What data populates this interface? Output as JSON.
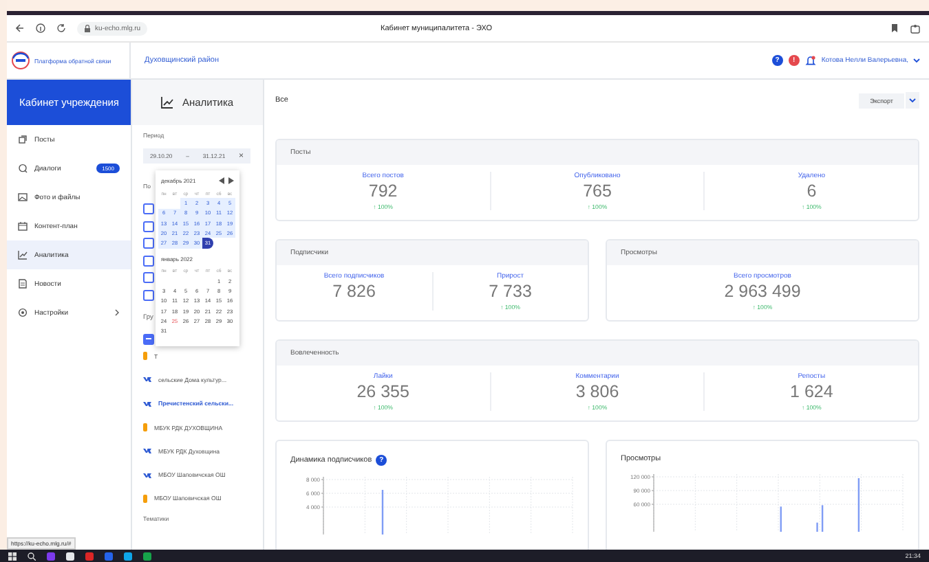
{
  "browser": {
    "url": "ku-echo.mlg.ru",
    "tab_title": "Кабинет муниципалитета - ЭХО",
    "status_url": "https://ku-echo.mlg.ru/#"
  },
  "header": {
    "platform_name": "Платформа обратной связи",
    "district": "Духовщинский район",
    "help": "?",
    "alert": "!",
    "user": "Котова Нелли Валерьевна,"
  },
  "sidebar": {
    "title": "Кабинет учреждения",
    "items": [
      {
        "label": "Посты",
        "kind": "posts",
        "selected": false,
        "submenu": false
      },
      {
        "label": "Диалоги",
        "kind": "dialogs",
        "badge": "1500",
        "selected": false,
        "submenu": false
      },
      {
        "label": "Фото и файлы",
        "kind": "photos",
        "selected": false,
        "submenu": false
      },
      {
        "label": "Контент-план",
        "kind": "plan",
        "selected": false,
        "submenu": false
      },
      {
        "label": "Аналитика",
        "kind": "analytics",
        "selected": true,
        "submenu": false
      },
      {
        "label": "Новости",
        "kind": "news",
        "selected": false,
        "submenu": false
      },
      {
        "label": "Настройки",
        "kind": "settings",
        "selected": false,
        "submenu": true
      }
    ]
  },
  "filters": {
    "title": "Аналитика",
    "period_label": "Период",
    "date_from": "29.10.20",
    "date_separator": "–",
    "date_to": "31.12.21",
    "clear": "×",
    "hidden_label": "По",
    "checkboxes": [
      {
        "checked": false
      },
      {
        "checked": false
      },
      {
        "checked": false
      },
      {
        "checked": false
      },
      {
        "checked": false
      },
      {
        "checked": false
      }
    ],
    "groups_label": "Гру",
    "groups_select_all": {
      "indeterminate": true
    },
    "groups": [
      {
        "kind": "ok",
        "label": "Т",
        "selected": false
      },
      {
        "kind": "vk",
        "label": "сельские Дома культур...",
        "selected": false
      },
      {
        "kind": "vk",
        "label": "Пречистенский сельски...",
        "selected": true
      },
      {
        "kind": "ok",
        "label": "МБУК РДК ДУХОВЩИНА",
        "selected": false
      },
      {
        "kind": "vk",
        "label": "МБУК РДК Духовщина",
        "selected": false
      },
      {
        "kind": "vk",
        "label": "МБОУ Шаповичская ОШ",
        "selected": false
      },
      {
        "kind": "ok",
        "label": "МБОУ Шаповичская ОШ",
        "selected": false
      }
    ],
    "topics_label": "Тематики"
  },
  "calendar": {
    "months": [
      {
        "title": "декабрь 2021",
        "weekdays": [
          "пн",
          "вт",
          "ср",
          "чт",
          "пт",
          "сб",
          "вс"
        ],
        "weeks": [
          [
            {
              "label": "1",
              "in_range": true,
              "selected": false,
              "today": false
            },
            {
              "label": "2",
              "in_range": true,
              "selected": false,
              "today": false
            },
            {
              "label": "3",
              "in_range": true,
              "selected": false,
              "today": false
            },
            {
              "label": "4",
              "in_range": true,
              "selected": false,
              "today": false
            },
            {
              "label": "5",
              "in_range": true,
              "selected": false,
              "today": false
            }
          ],
          [
            {
              "label": "6",
              "in_range": true,
              "selected": false,
              "today": false
            },
            {
              "label": "7",
              "in_range": true,
              "selected": false,
              "today": false
            },
            {
              "label": "8",
              "in_range": true,
              "selected": false,
              "today": false
            },
            {
              "label": "9",
              "in_range": true,
              "selected": false,
              "today": false
            },
            {
              "label": "10",
              "in_range": true,
              "selected": false,
              "today": false
            },
            {
              "label": "11",
              "in_range": true,
              "selected": false,
              "today": false
            },
            {
              "label": "12",
              "in_range": true,
              "selected": false,
              "today": false
            }
          ],
          [
            {
              "label": "13",
              "in_range": true,
              "selected": false,
              "today": false
            },
            {
              "label": "14",
              "in_range": true,
              "selected": false,
              "today": false
            },
            {
              "label": "15",
              "in_range": true,
              "selected": false,
              "today": false
            },
            {
              "label": "16",
              "in_range": true,
              "selected": false,
              "today": false
            },
            {
              "label": "17",
              "in_range": true,
              "selected": false,
              "today": false
            },
            {
              "label": "18",
              "in_range": true,
              "selected": false,
              "today": false
            },
            {
              "label": "19",
              "in_range": true,
              "selected": false,
              "today": false
            }
          ],
          [
            {
              "label": "20",
              "in_range": true,
              "selected": false,
              "today": false
            },
            {
              "label": "21",
              "in_range": true,
              "selected": false,
              "today": false
            },
            {
              "label": "22",
              "in_range": true,
              "selected": false,
              "today": false
            },
            {
              "label": "23",
              "in_range": true,
              "selected": false,
              "today": false
            },
            {
              "label": "24",
              "in_range": true,
              "selected": false,
              "today": false
            },
            {
              "label": "25",
              "in_range": true,
              "selected": false,
              "today": false
            },
            {
              "label": "26",
              "in_range": true,
              "selected": false,
              "today": false
            }
          ],
          [
            {
              "label": "27",
              "in_range": true,
              "selected": false,
              "today": false
            },
            {
              "label": "28",
              "in_range": true,
              "selected": false,
              "today": false
            },
            {
              "label": "29",
              "in_range": true,
              "selected": false,
              "today": false
            },
            {
              "label": "30",
              "in_range": true,
              "selected": false,
              "today": false
            },
            {
              "label": "31",
              "in_range": true,
              "selected": true,
              "today": false
            }
          ]
        ]
      },
      {
        "title": "январь 2022",
        "weekdays": [
          "пн",
          "вт",
          "ср",
          "чт",
          "пт",
          "сб",
          "вс"
        ],
        "weeks": [
          [
            {
              "label": "1",
              "in_range": false,
              "selected": false,
              "today": false
            },
            {
              "label": "2",
              "in_range": false,
              "selected": false,
              "today": false
            }
          ],
          [
            {
              "label": "3",
              "in_range": false,
              "selected": false,
              "today": false
            },
            {
              "label": "4",
              "in_range": false,
              "selected": false,
              "today": false
            },
            {
              "label": "5",
              "in_range": false,
              "selected": false,
              "today": false
            },
            {
              "label": "6",
              "in_range": false,
              "selected": false,
              "today": false
            },
            {
              "label": "7",
              "in_range": false,
              "selected": false,
              "today": false
            },
            {
              "label": "8",
              "in_range": false,
              "selected": false,
              "today": false
            },
            {
              "label": "9",
              "in_range": false,
              "selected": false,
              "today": false
            }
          ],
          [
            {
              "label": "10",
              "in_range": false,
              "selected": false,
              "today": false
            },
            {
              "label": "11",
              "in_range": false,
              "selected": false,
              "today": false
            },
            {
              "label": "12",
              "in_range": false,
              "selected": false,
              "today": false
            },
            {
              "label": "13",
              "in_range": false,
              "selected": false,
              "today": false
            },
            {
              "label": "14",
              "in_range": false,
              "selected": false,
              "today": false
            },
            {
              "label": "15",
              "in_range": false,
              "selected": false,
              "today": false
            },
            {
              "label": "16",
              "in_range": false,
              "selected": false,
              "today": false
            }
          ],
          [
            {
              "label": "17",
              "in_range": false,
              "selected": false,
              "today": false
            },
            {
              "label": "18",
              "in_range": false,
              "selected": false,
              "today": false
            },
            {
              "label": "19",
              "in_range": false,
              "selected": false,
              "today": false
            },
            {
              "label": "20",
              "in_range": false,
              "selected": false,
              "today": false
            },
            {
              "label": "21",
              "in_range": false,
              "selected": false,
              "today": false
            },
            {
              "label": "22",
              "in_range": false,
              "selected": false,
              "today": false
            },
            {
              "label": "23",
              "in_range": false,
              "selected": false,
              "today": false
            }
          ],
          [
            {
              "label": "24",
              "in_range": false,
              "selected": false,
              "today": false
            },
            {
              "label": "25",
              "in_range": false,
              "selected": false,
              "today": true
            },
            {
              "label": "26",
              "in_range": false,
              "selected": false,
              "today": false
            },
            {
              "label": "27",
              "in_range": false,
              "selected": false,
              "today": false
            },
            {
              "label": "28",
              "in_range": false,
              "selected": false,
              "today": false
            },
            {
              "label": "29",
              "in_range": false,
              "selected": false,
              "today": false
            },
            {
              "label": "30",
              "in_range": false,
              "selected": false,
              "today": false
            }
          ],
          [
            {
              "label": "31",
              "in_range": false,
              "selected": false,
              "today": false
            }
          ]
        ]
      }
    ]
  },
  "content": {
    "filter_label": "Все",
    "export": "Экспорт",
    "card_rows": [
      [
        {
          "kind": "stats",
          "title": "Посты",
          "stats": [
            {
              "label": "Всего постов",
              "value": "792",
              "change": "↑ 100%"
            },
            {
              "label": "Опубликовано",
              "value": "765",
              "change": "↑ 100%"
            },
            {
              "label": "Удалено",
              "value": "6",
              "change": "↑ 100%"
            }
          ]
        }
      ],
      [
        {
          "kind": "stats",
          "title": "Подписчики",
          "stats": [
            {
              "label": "Всего подписчиков",
              "value": "7 826"
            },
            {
              "label": "Прирост",
              "value": "7 733",
              "change": "↑ 100%"
            }
          ]
        },
        {
          "kind": "stats",
          "title": "Просмотры",
          "stats": [
            {
              "label": "Всего просмотров",
              "value": "2 963 499",
              "change": "↑ 100%"
            }
          ]
        }
      ],
      [
        {
          "kind": "stats",
          "title": "Вовлеченность",
          "stats": [
            {
              "label": "Лайки",
              "value": "26 355",
              "change": "↑ 100%"
            },
            {
              "label": "Комментарии",
              "value": "3 806",
              "change": "↑ 100%"
            },
            {
              "label": "Репосты",
              "value": "1 624",
              "change": "↑ 100%"
            }
          ]
        }
      ],
      [
        {
          "kind": "chart",
          "title": "Динамика подписчиков",
          "help": "?",
          "chart_data": {
            "type": "bar",
            "grid": true,
            "ylim": [
              0,
              8000
            ],
            "yticks": [
              {
                "value": 4000,
                "label": "4 000"
              },
              {
                "value": 6000,
                "label": "6 000"
              },
              {
                "value": 8000,
                "label": "8 000"
              }
            ],
            "series": [
              {
                "color": "#7f9cf5",
                "values": [
                  0,
                  0,
                  0,
                  0,
                  0,
                  0,
                  0,
                  0,
                  0,
                  6500,
                  0,
                  0,
                  0,
                  0,
                  0,
                  0,
                  0,
                  0,
                  0,
                  0,
                  0,
                  0,
                  0,
                  0,
                  0,
                  0,
                  0,
                  0,
                  0,
                  0,
                  0,
                  0,
                  0,
                  0,
                  0,
                  0,
                  0,
                  0,
                  0,
                  0
                ]
              }
            ]
          }
        },
        {
          "kind": "chart",
          "title": "Просмотры",
          "chart_data": {
            "type": "bar",
            "grid": true,
            "ylim": [
              0,
              120000
            ],
            "yticks": [
              {
                "value": 60000,
                "label": "60 000"
              },
              {
                "value": 90000,
                "label": "90 000"
              },
              {
                "value": 120000,
                "label": "120 000"
              }
            ],
            "series": [
              {
                "color": "#7f9cf5",
                "values": [
                  0,
                  0,
                  0,
                  0,
                  0,
                  0,
                  0,
                  0,
                  0,
                  0,
                  0,
                  0,
                  0,
                  0,
                  0,
                  0,
                  0,
                  0,
                  0,
                  0,
                  0,
                  0,
                  0,
                  0,
                  55000,
                  0,
                  0,
                  0,
                  0,
                  0,
                  0,
                  20000,
                  58000,
                  0,
                  0,
                  0,
                  0,
                  0,
                  0,
                  117000,
                  0,
                  0,
                  0,
                  0,
                  0,
                  0,
                  0,
                  0
                ]
              }
            ]
          }
        }
      ]
    ]
  },
  "taskbar": {
    "clock": "21:34"
  }
}
